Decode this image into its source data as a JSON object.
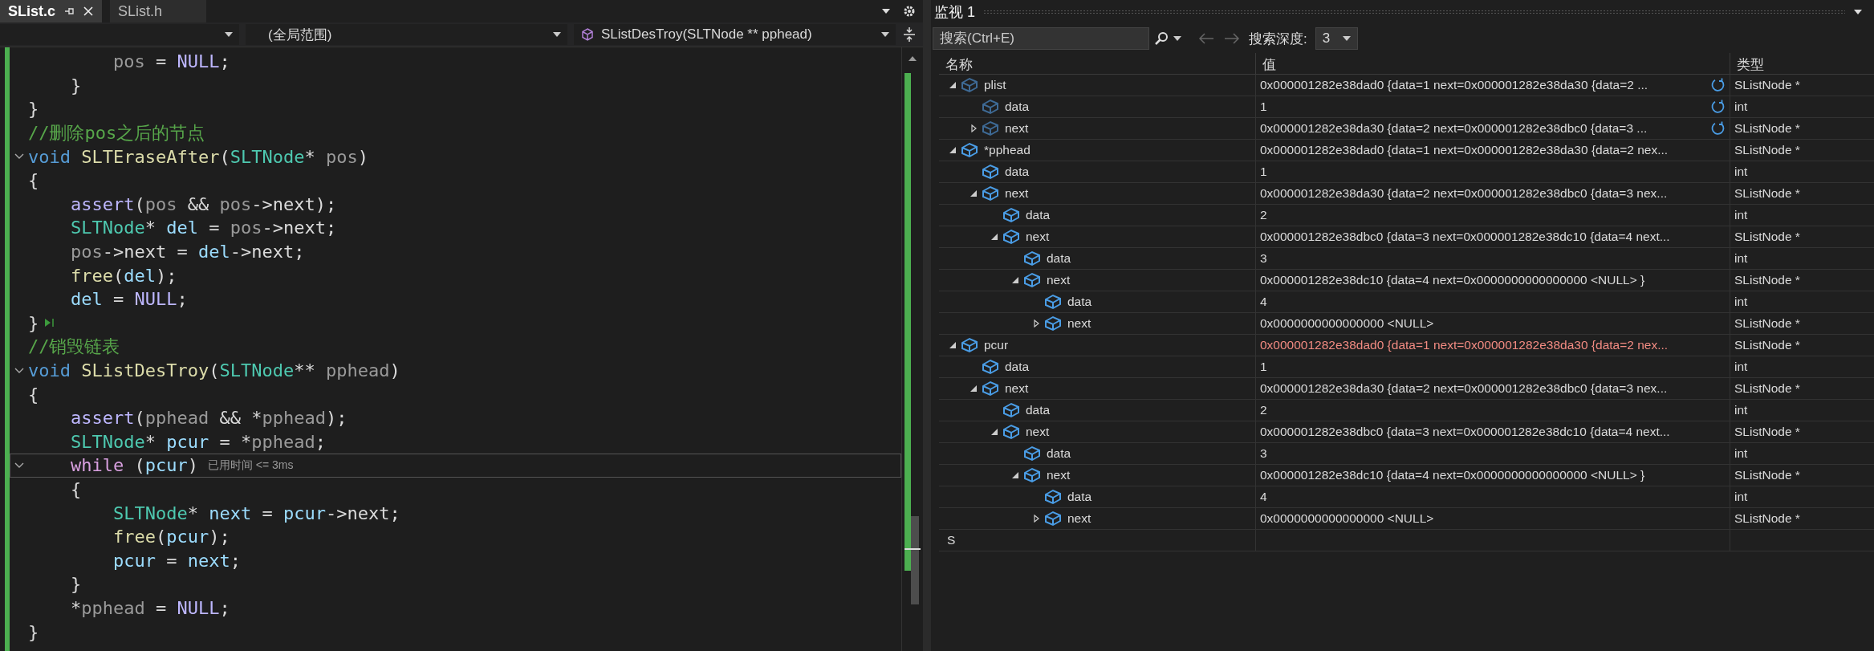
{
  "editor": {
    "tabs": [
      {
        "label": "SList.c",
        "selected": true
      },
      {
        "label": "SList.h",
        "selected": false
      }
    ],
    "scope_dropdowns": [
      {
        "label": "(全局范围)"
      },
      {
        "label": "SListDesTroy(SLTNode ** pphead)",
        "kind": "function"
      }
    ],
    "lines": [
      {
        "tokens": [
          {
            "kind": "param",
            "text": "        pos"
          },
          {
            "kind": "plain",
            "text": " = "
          },
          {
            "kind": "macro",
            "text": "NULL"
          },
          {
            "kind": "plain",
            "text": ";"
          }
        ]
      },
      {
        "tokens": [
          {
            "kind": "plain",
            "text": "    }"
          }
        ]
      },
      {
        "tokens": [
          {
            "kind": "plain",
            "text": "}"
          }
        ]
      },
      {
        "tokens": [
          {
            "kind": "comment",
            "text": "//删除pos之后的节点"
          }
        ]
      },
      {
        "fold": true,
        "tokens": [
          {
            "kind": "keyword",
            "text": "void "
          },
          {
            "kind": "func",
            "text": "SLTEraseAfter"
          },
          {
            "kind": "plain",
            "text": "("
          },
          {
            "kind": "type",
            "text": "SLTNode"
          },
          {
            "kind": "plain",
            "text": "* "
          },
          {
            "kind": "param",
            "text": "pos"
          },
          {
            "kind": "plain",
            "text": ")"
          }
        ]
      },
      {
        "tokens": [
          {
            "kind": "plain",
            "text": "{"
          }
        ]
      },
      {
        "tokens": [
          {
            "kind": "macro",
            "text": "    assert"
          },
          {
            "kind": "plain",
            "text": "("
          },
          {
            "kind": "param",
            "text": "pos"
          },
          {
            "kind": "plain",
            "text": " && "
          },
          {
            "kind": "param",
            "text": "pos"
          },
          {
            "kind": "plain",
            "text": "->next);"
          }
        ]
      },
      {
        "tokens": [
          {
            "kind": "type",
            "text": "    SLTNode"
          },
          {
            "kind": "plain",
            "text": "* "
          },
          {
            "kind": "local",
            "text": "del"
          },
          {
            "kind": "plain",
            "text": " = "
          },
          {
            "kind": "param",
            "text": "pos"
          },
          {
            "kind": "plain",
            "text": "->next;"
          }
        ]
      },
      {
        "tokens": [
          {
            "kind": "param",
            "text": "    pos"
          },
          {
            "kind": "plain",
            "text": "->next = "
          },
          {
            "kind": "local",
            "text": "del"
          },
          {
            "kind": "plain",
            "text": "->next;"
          }
        ]
      },
      {
        "tokens": [
          {
            "kind": "func",
            "text": "    free"
          },
          {
            "kind": "plain",
            "text": "("
          },
          {
            "kind": "local",
            "text": "del"
          },
          {
            "kind": "plain",
            "text": ");"
          }
        ]
      },
      {
        "tokens": [
          {
            "kind": "local",
            "text": "    del"
          },
          {
            "kind": "plain",
            "text": " = "
          },
          {
            "kind": "macro",
            "text": "NULL"
          },
          {
            "kind": "plain",
            "text": ";"
          }
        ]
      },
      {
        "run_marker": true,
        "tokens": [
          {
            "kind": "plain",
            "text": "}"
          }
        ]
      },
      {
        "tokens": [
          {
            "kind": "comment",
            "text": "//销毁链表"
          }
        ]
      },
      {
        "fold": true,
        "tokens": [
          {
            "kind": "keyword",
            "text": "void "
          },
          {
            "kind": "func",
            "text": "SListDesTroy"
          },
          {
            "kind": "plain",
            "text": "("
          },
          {
            "kind": "type",
            "text": "SLTNode"
          },
          {
            "kind": "plain",
            "text": "** "
          },
          {
            "kind": "param",
            "text": "pphead"
          },
          {
            "kind": "plain",
            "text": ")"
          }
        ]
      },
      {
        "tokens": [
          {
            "kind": "plain",
            "text": "{"
          }
        ]
      },
      {
        "tokens": [
          {
            "kind": "macro",
            "text": "    assert"
          },
          {
            "kind": "plain",
            "text": "("
          },
          {
            "kind": "param",
            "text": "pphead"
          },
          {
            "kind": "plain",
            "text": " && *"
          },
          {
            "kind": "param",
            "text": "pphead"
          },
          {
            "kind": "plain",
            "text": ");"
          }
        ]
      },
      {
        "tokens": [
          {
            "kind": "type",
            "text": "    SLTNode"
          },
          {
            "kind": "plain",
            "text": "* "
          },
          {
            "kind": "local",
            "text": "pcur"
          },
          {
            "kind": "plain",
            "text": " = *"
          },
          {
            "kind": "param",
            "text": "pphead"
          },
          {
            "kind": "plain",
            "text": ";"
          }
        ]
      },
      {
        "fold": true,
        "current": true,
        "hint": "已用时间 <= 3ms",
        "tokens": [
          {
            "kind": "control",
            "text": "    while"
          },
          {
            "kind": "plain",
            "text": " ("
          },
          {
            "kind": "local",
            "text": "pcur"
          },
          {
            "kind": "plain",
            "text": ")"
          }
        ]
      },
      {
        "tokens": [
          {
            "kind": "plain",
            "text": "    {"
          }
        ]
      },
      {
        "tokens": [
          {
            "kind": "type",
            "text": "        SLTNode"
          },
          {
            "kind": "plain",
            "text": "* "
          },
          {
            "kind": "local",
            "text": "next"
          },
          {
            "kind": "plain",
            "text": " = "
          },
          {
            "kind": "local",
            "text": "pcur"
          },
          {
            "kind": "plain",
            "text": "->next;"
          }
        ]
      },
      {
        "tokens": [
          {
            "kind": "func",
            "text": "        free"
          },
          {
            "kind": "plain",
            "text": "("
          },
          {
            "kind": "local",
            "text": "pcur"
          },
          {
            "kind": "plain",
            "text": ");"
          }
        ]
      },
      {
        "tokens": [
          {
            "kind": "local",
            "text": "        pcur"
          },
          {
            "kind": "plain",
            "text": " = "
          },
          {
            "kind": "local",
            "text": "next"
          },
          {
            "kind": "plain",
            "text": ";"
          }
        ]
      },
      {
        "tokens": [
          {
            "kind": "plain",
            "text": "    }"
          }
        ]
      },
      {
        "tokens": [
          {
            "kind": "plain",
            "text": "    *"
          },
          {
            "kind": "param",
            "text": "pphead"
          },
          {
            "kind": "plain",
            "text": " = "
          },
          {
            "kind": "macro",
            "text": "NULL"
          },
          {
            "kind": "plain",
            "text": ";"
          }
        ]
      },
      {
        "tokens": [
          {
            "kind": "plain",
            "text": "}"
          }
        ]
      }
    ]
  },
  "watch": {
    "title": "监视 1",
    "search": {
      "placeholder": "搜索(Ctrl+E)"
    },
    "depth_label": "搜索深度:",
    "depth_value": "3",
    "columns": [
      "名称",
      "值",
      "类型"
    ],
    "rows": [
      {
        "name": "plist",
        "value": "0x000001282e38dad0 {data=1 next=0x000001282e38da30 {data=2 ...",
        "type": "SListNode *",
        "expanded": true,
        "stale": true,
        "changed": false,
        "children": [
          {
            "name": "data",
            "value": "1",
            "type": "int",
            "stale": true,
            "changed": false
          },
          {
            "name": "next",
            "value": "0x000001282e38da30 {data=2 next=0x000001282e38dbc0 {data=3 ...",
            "type": "SListNode *",
            "expanded": false,
            "stale": true,
            "changed": false
          }
        ]
      },
      {
        "name": "*pphead",
        "value": "0x000001282e38dad0 {data=1 next=0x000001282e38da30 {data=2 nex...",
        "type": "SListNode *",
        "expanded": true,
        "stale": false,
        "changed": false,
        "children": [
          {
            "name": "data",
            "value": "1",
            "type": "int",
            "stale": false,
            "changed": false
          },
          {
            "name": "next",
            "value": "0x000001282e38da30 {data=2 next=0x000001282e38dbc0 {data=3 nex...",
            "type": "SListNode *",
            "expanded": true,
            "stale": false,
            "changed": false,
            "children": [
              {
                "name": "data",
                "value": "2",
                "type": "int",
                "stale": false,
                "changed": false
              },
              {
                "name": "next",
                "value": "0x000001282e38dbc0 {data=3 next=0x000001282e38dc10 {data=4 next...",
                "type": "SListNode *",
                "expanded": true,
                "stale": false,
                "changed": false,
                "children": [
                  {
                    "name": "data",
                    "value": "3",
                    "type": "int",
                    "stale": false,
                    "changed": false
                  },
                  {
                    "name": "next",
                    "value": "0x000001282e38dc10 {data=4 next=0x0000000000000000 <NULL> }",
                    "type": "SListNode *",
                    "expanded": true,
                    "stale": false,
                    "changed": false,
                    "children": [
                      {
                        "name": "data",
                        "value": "4",
                        "type": "int",
                        "stale": false,
                        "changed": false
                      },
                      {
                        "name": "next",
                        "value": "0x0000000000000000 <NULL>",
                        "type": "SListNode *",
                        "expanded": false,
                        "stale": false,
                        "changed": false
                      }
                    ]
                  }
                ]
              }
            ]
          }
        ]
      },
      {
        "name": "pcur",
        "value": "0x000001282e38dad0 {data=1 next=0x000001282e38da30 {data=2 nex...",
        "type": "SListNode *",
        "expanded": true,
        "stale": false,
        "changed": true,
        "children": [
          {
            "name": "data",
            "value": "1",
            "type": "int",
            "stale": false,
            "changed": false
          },
          {
            "name": "next",
            "value": "0x000001282e38da30 {data=2 next=0x000001282e38dbc0 {data=3 nex...",
            "type": "SListNode *",
            "expanded": true,
            "stale": false,
            "changed": false,
            "children": [
              {
                "name": "data",
                "value": "2",
                "type": "int",
                "stale": false,
                "changed": false
              },
              {
                "name": "next",
                "value": "0x000001282e38dbc0 {data=3 next=0x000001282e38dc10 {data=4 next...",
                "type": "SListNode *",
                "expanded": true,
                "stale": false,
                "changed": false,
                "children": [
                  {
                    "name": "data",
                    "value": "3",
                    "type": "int",
                    "stale": false,
                    "changed": false
                  },
                  {
                    "name": "next",
                    "value": "0x000001282e38dc10 {data=4 next=0x0000000000000000 <NULL> }",
                    "type": "SListNode *",
                    "expanded": true,
                    "stale": false,
                    "changed": false,
                    "children": [
                      {
                        "name": "data",
                        "value": "4",
                        "type": "int",
                        "stale": false,
                        "changed": false
                      },
                      {
                        "name": "next",
                        "value": "0x0000000000000000 <NULL>",
                        "type": "SListNode *",
                        "expanded": false,
                        "stale": false,
                        "changed": false
                      }
                    ]
                  }
                ]
              }
            ]
          }
        ]
      }
    ],
    "new_item": {
      "value": "S"
    }
  }
}
